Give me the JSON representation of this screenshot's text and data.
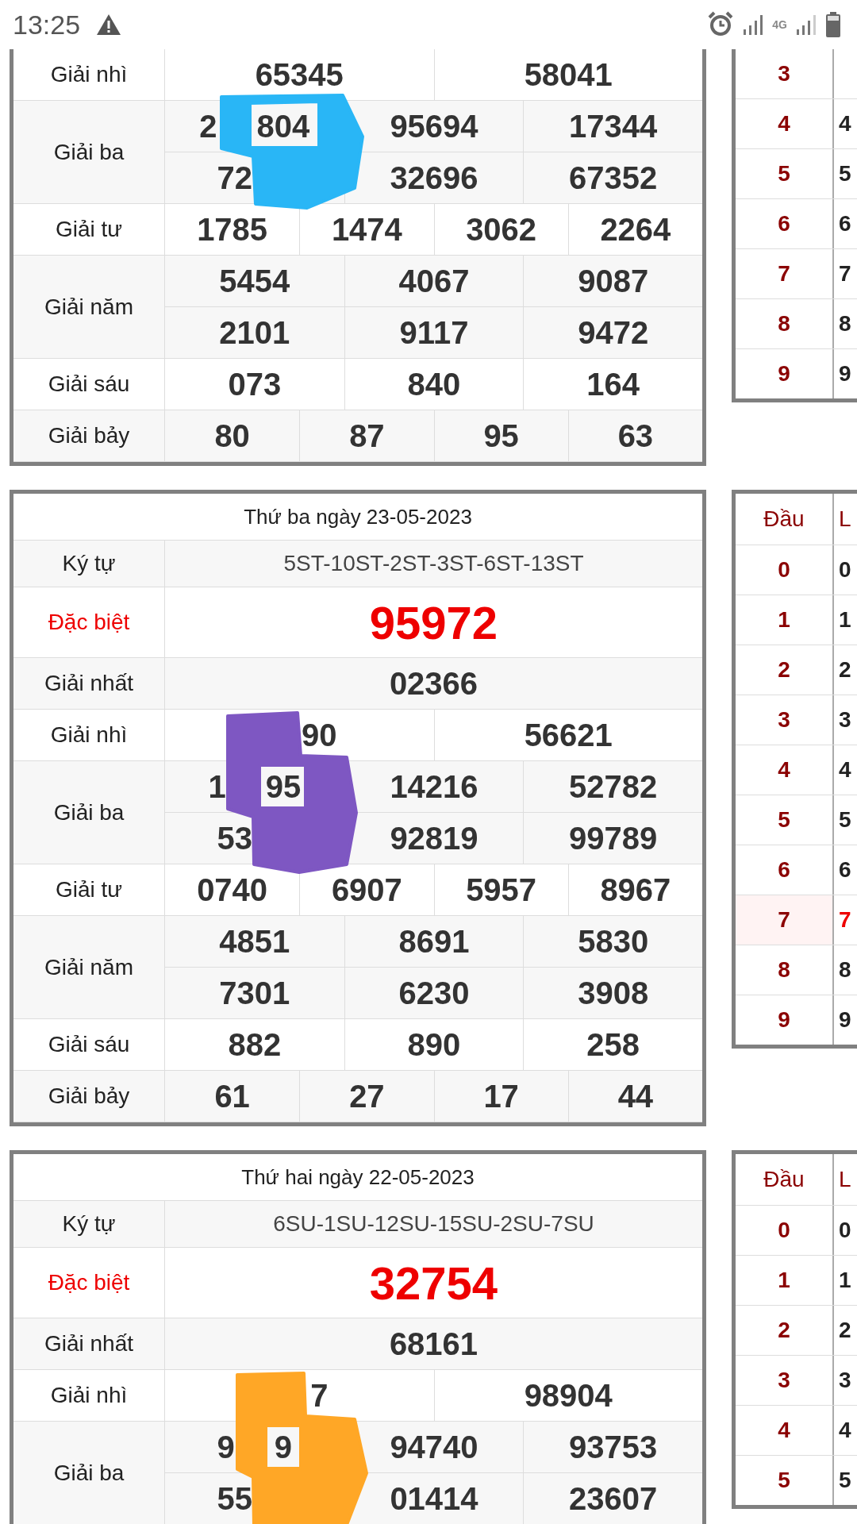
{
  "status_bar": {
    "time": "13:25",
    "network": "4G"
  },
  "blocks": [
    {
      "cut_top": true,
      "scribble": {
        "color": "#29b6f6"
      },
      "rows": [
        {
          "label": "Giải nhì",
          "kind": "prize",
          "lines": [
            [
              [
                {
                  "kind": "digits",
                  "text": "65345"
                }
              ],
              "58041"
            ]
          ]
        },
        {
          "label": "Giải ba",
          "kind": "prize",
          "lines": [
            [
              [
                {
                  "kind": "digits",
                  "text": "2"
                },
                {
                  "kind": "covered"
                },
                {
                  "kind": "digits",
                  "text": "804"
                }
              ],
              "95694",
              "17344"
            ],
            [
              [
                {
                  "kind": "digits",
                  "text": "72"
                },
                {
                  "kind": "covered"
                }
              ],
              "32696",
              "67352"
            ]
          ]
        },
        {
          "label": "Giải tư",
          "kind": "prize",
          "lines": [
            [
              "1785",
              "1474",
              "3062",
              "2264"
            ]
          ]
        },
        {
          "label": "Giải năm",
          "kind": "prize",
          "lines": [
            [
              "5454",
              "4067",
              "9087"
            ],
            [
              "2101",
              "9117",
              "9472"
            ]
          ]
        },
        {
          "label": "Giải sáu",
          "kind": "prize",
          "lines": [
            [
              "073",
              "840",
              "164"
            ]
          ]
        },
        {
          "label": "Giải bảy",
          "kind": "prize",
          "lines": [
            [
              "80",
              "87",
              "95",
              "63"
            ]
          ]
        }
      ],
      "side": {
        "cut_top": true,
        "rows": [
          {
            "head": "3",
            "highlight": false
          },
          {
            "head": "4",
            "tail": "4",
            "highlight": false
          },
          {
            "head": "5",
            "tail": "5",
            "highlight": false
          },
          {
            "head": "6",
            "tail": "6",
            "highlight": false
          },
          {
            "head": "7",
            "tail": "7",
            "highlight": false
          },
          {
            "head": "8",
            "tail": "8",
            "highlight": false
          },
          {
            "head": "9",
            "tail": "9",
            "highlight": false
          }
        ]
      }
    },
    {
      "cut_top": false,
      "title": "Thứ ba ngày 23-05-2023",
      "scribble": {
        "color": "#7e57c2"
      },
      "rows": [
        {
          "label": "Ký tự",
          "kind": "code",
          "lines": [
            [
              "5ST-10ST-2ST-3ST-6ST-13ST"
            ]
          ]
        },
        {
          "label": "Đặc biệt",
          "kind": "special",
          "lines": [
            [
              "95972"
            ]
          ]
        },
        {
          "label": "Giải nhất",
          "kind": "prize",
          "lines": [
            [
              "02366"
            ]
          ]
        },
        {
          "label": "Giải nhì",
          "kind": "prize",
          "lines": [
            [
              [
                {
                  "kind": "covered"
                },
                {
                  "kind": "digits",
                  "text": "90"
                }
              ],
              "56621"
            ]
          ]
        },
        {
          "label": "Giải ba",
          "kind": "prize",
          "lines": [
            [
              [
                {
                  "kind": "digits",
                  "text": "1"
                },
                {
                  "kind": "covered"
                },
                {
                  "kind": "digits",
                  "text": "95"
                }
              ],
              "14216",
              "52782"
            ],
            [
              [
                {
                  "kind": "digits",
                  "text": "53"
                },
                {
                  "kind": "covered"
                }
              ],
              "92819",
              "99789"
            ]
          ]
        },
        {
          "label": "Giải tư",
          "kind": "prize",
          "lines": [
            [
              "0740",
              "6907",
              "5957",
              "8967"
            ]
          ]
        },
        {
          "label": "Giải năm",
          "kind": "prize",
          "lines": [
            [
              "4851",
              "8691",
              "5830"
            ],
            [
              "7301",
              "6230",
              "3908"
            ]
          ]
        },
        {
          "label": "Giải sáu",
          "kind": "prize",
          "lines": [
            [
              "882",
              "890",
              "258"
            ]
          ]
        },
        {
          "label": "Giải bảy",
          "kind": "prize",
          "lines": [
            [
              "61",
              "27",
              "17",
              "44"
            ]
          ]
        }
      ],
      "side": {
        "cut_top": false,
        "header": [
          "Đầu",
          "L"
        ],
        "rows": [
          {
            "head": "0",
            "tail": "0",
            "highlight": false
          },
          {
            "head": "1",
            "tail": "1",
            "highlight": false
          },
          {
            "head": "2",
            "tail": "2",
            "highlight": false
          },
          {
            "head": "3",
            "tail": "3",
            "highlight": false
          },
          {
            "head": "4",
            "tail": "4",
            "highlight": false
          },
          {
            "head": "5",
            "tail": "5",
            "highlight": false
          },
          {
            "head": "6",
            "tail": "6",
            "highlight": false
          },
          {
            "head": "7",
            "tail": "7",
            "highlight": true
          },
          {
            "head": "8",
            "tail": "8",
            "highlight": false
          },
          {
            "head": "9",
            "tail": "9",
            "highlight": false
          }
        ]
      }
    },
    {
      "cut_top": false,
      "title": "Thứ hai ngày 22-05-2023",
      "scribble": {
        "color": "#ffa726"
      },
      "rows": [
        {
          "label": "Ký tự",
          "kind": "code",
          "lines": [
            [
              "6SU-1SU-12SU-15SU-2SU-7SU"
            ]
          ]
        },
        {
          "label": "Đặc biệt",
          "kind": "special",
          "lines": [
            [
              "32754"
            ]
          ]
        },
        {
          "label": "Giải nhất",
          "kind": "prize",
          "lines": [
            [
              "68161"
            ]
          ]
        },
        {
          "label": "Giải nhì",
          "kind": "prize",
          "lines": [
            [
              [
                {
                  "kind": "covered"
                },
                {
                  "kind": "digits",
                  "text": "7"
                }
              ],
              "98904"
            ]
          ]
        },
        {
          "label": "Giải ba",
          "kind": "prize",
          "lines": [
            [
              [
                {
                  "kind": "digits",
                  "text": "9"
                },
                {
                  "kind": "covered"
                },
                {
                  "kind": "digits",
                  "text": "9"
                }
              ],
              "94740",
              "93753"
            ],
            [
              [
                {
                  "kind": "digits",
                  "text": "55"
                },
                {
                  "kind": "covered"
                }
              ],
              "01414",
              "23607"
            ]
          ]
        }
      ],
      "side": {
        "cut_top": false,
        "header": [
          "Đầu",
          "L"
        ],
        "rows": [
          {
            "head": "0",
            "tail": "0",
            "highlight": false
          },
          {
            "head": "1",
            "tail": "1",
            "highlight": false
          },
          {
            "head": "2",
            "tail": "2",
            "highlight": false
          },
          {
            "head": "3",
            "tail": "3",
            "highlight": false
          },
          {
            "head": "4",
            "tail": "4",
            "highlight": false
          },
          {
            "head": "5",
            "tail": "5",
            "highlight": false
          }
        ]
      }
    }
  ]
}
